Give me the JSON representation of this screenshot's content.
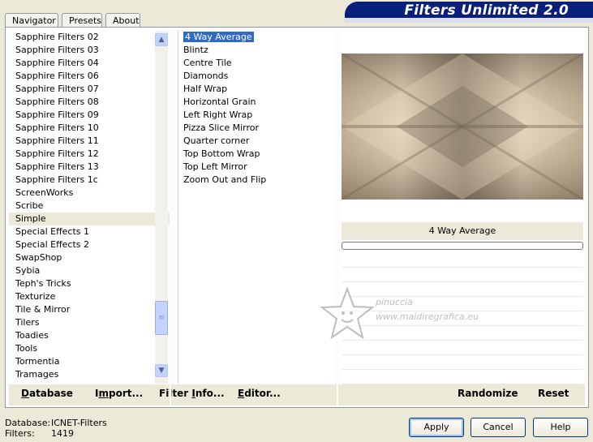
{
  "window": {
    "banner_title": "Filters Unlimited 2.0"
  },
  "tabs": [
    {
      "label": "Navigator",
      "active": true
    },
    {
      "label": "Presets",
      "active": false
    },
    {
      "label": "About",
      "active": false
    }
  ],
  "categories": {
    "items": [
      "Sapphire Filters 02",
      "Sapphire Filters 03",
      "Sapphire Filters 04",
      "Sapphire Filters 06",
      "Sapphire Filters 07",
      "Sapphire Filters 08",
      "Sapphire Filters 09",
      "Sapphire Filters 10",
      "Sapphire Filters 11",
      "Sapphire Filters 12",
      "Sapphire Filters 13",
      "Sapphire Filters 1c",
      "ScreenWorks",
      "Scribe",
      "Simple",
      "Special Effects 1",
      "Special Effects 2",
      "SwapShop",
      "Sybia",
      "Teph's Tricks",
      "Texturize",
      "Tile & Mirror",
      "Tilers",
      "Toadies",
      "Tools",
      "Tormentia",
      "Tramages"
    ],
    "selected": "Simple",
    "scroll_position": 0.82
  },
  "filters": {
    "items": [
      "4 Way Average",
      "Blintz",
      "Centre Tile",
      "Diamonds",
      "Half Wrap",
      "Horizontal Grain",
      "Left Right Wrap",
      "Pizza Slice Mirror",
      "Quarter corner",
      "Top Bottom Wrap",
      "Top Left Mirror",
      "Zoom Out and Flip"
    ],
    "selected": "4 Way Average"
  },
  "preview": {
    "filter_name": "4 Way Average",
    "progress": 0,
    "colors": {
      "light": "#e6d6bd",
      "mid": "#b8a488",
      "dark": "#6e6150"
    }
  },
  "watermark": {
    "line1": "pinuccia",
    "line2": "www.maidiregrafica.eu"
  },
  "toolbar": {
    "database_u": "D",
    "database_rest": "atabase",
    "import_pre": "I",
    "import_u": "m",
    "import_rest": "port...",
    "info_pre": "Filter ",
    "info_u": "I",
    "info_rest": "nfo...",
    "editor_u": "E",
    "editor_rest": "ditor...",
    "randomize": "Randomize",
    "reset": "Reset"
  },
  "status": {
    "database_label": "Database:",
    "database_value": "ICNET-Filters",
    "filters_label": "Filters:",
    "filters_value": "1419"
  },
  "buttons": {
    "apply": "Apply",
    "cancel": "Cancel",
    "help": "Help"
  }
}
